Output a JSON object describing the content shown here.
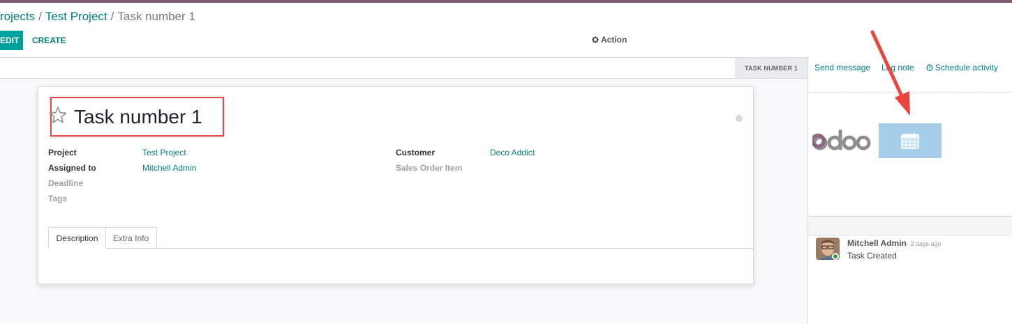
{
  "breadcrumb": {
    "items": [
      "rojects",
      "Test Project"
    ],
    "separator": "/",
    "current": "Task number 1"
  },
  "control_panel": {
    "edit_label": "EDIT",
    "create_label": "CREATE",
    "action_label": "Action"
  },
  "statusbar": {
    "stage": "TASK NUMBER 1"
  },
  "form": {
    "title": "Task number 1",
    "fields_left": [
      {
        "label": "Project",
        "value": "Test Project"
      },
      {
        "label": "Assigned to",
        "value": "Mitchell Admin"
      },
      {
        "label": "Deadline",
        "value": ""
      },
      {
        "label": "Tags",
        "value": ""
      }
    ],
    "fields_right": [
      {
        "label": "Customer",
        "value": "Deco Addict"
      },
      {
        "label": "Sales Order Item",
        "value": ""
      }
    ],
    "tabs": [
      "Description",
      "Extra Info"
    ]
  },
  "chatter": {
    "send_message": "Send message",
    "log_note": "Log note",
    "schedule_activity": "Schedule activity",
    "messages": [
      {
        "author": "Mitchell Admin",
        "date": "- 2 days ago",
        "body": "Task Created"
      }
    ]
  },
  "colors": {
    "accent": "#017e84",
    "edit_button": "#00a09d",
    "highlight_box": "#e44c4c",
    "annotation_arrow": "#e8463d",
    "topbar": "#7c5a72"
  },
  "icons": [
    "star-icon",
    "gear-icon",
    "clock-icon",
    "calendar-icon"
  ]
}
